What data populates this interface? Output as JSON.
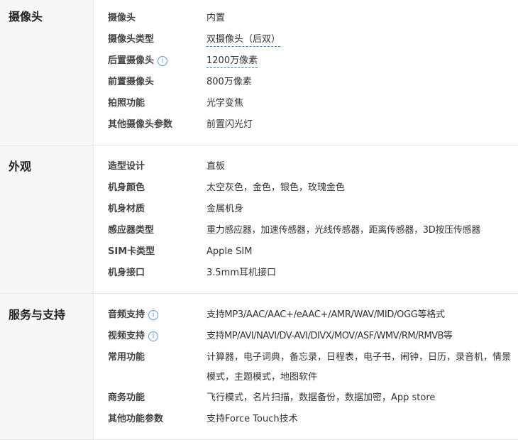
{
  "sections": [
    {
      "title": "摄像头",
      "rows": [
        {
          "label": "摄像头",
          "value": "内置"
        },
        {
          "label": "摄像头类型",
          "value": "双摄像头（后双）"
        },
        {
          "label": "后置摄像头",
          "value": "1200万像素"
        },
        {
          "label": "前置摄像头",
          "value": "800万像素"
        },
        {
          "label": "拍照功能",
          "value": "光学变焦"
        },
        {
          "label": "其他摄像头参数",
          "value": "前置闪光灯"
        }
      ]
    },
    {
      "title": "外观",
      "rows": [
        {
          "label": "造型设计",
          "value": "直板"
        },
        {
          "label": "机身颜色",
          "value": "太空灰色，金色，银色，玫瑰金色"
        },
        {
          "label": "机身材质",
          "value": "金属机身"
        },
        {
          "label": "感应器类型",
          "value": "重力感应器，加速传感器，光线传感器，距离传感器，3D按压传感器"
        },
        {
          "label": "SIM卡类型",
          "value": "Apple SIM"
        },
        {
          "label": "机身接口",
          "value": "3.5mm耳机接口"
        }
      ]
    },
    {
      "title": "服务与支持",
      "rows": [
        {
          "label": "音频支持",
          "value": "支持MP3/AAC/AAC+/eAAC+/AMR/WAV/MID/OGG等格式"
        },
        {
          "label": "视频支持",
          "value": "支持MP/AVI/NAVI/DV-AVI/DIVX/MOV/ASF/WMV/RM/RMVB等"
        },
        {
          "label": "常用功能",
          "value": "计算器，电子词典，备忘录，日程表，电子书，闹钟，日历，录音机，情景模式，主题模式，地图软件"
        },
        {
          "label": "商务功能",
          "value": "飞行模式，名片扫描，数据备份，数据加密，App store"
        },
        {
          "label": "其他功能参数",
          "value": "支持Force Touch技术"
        }
      ]
    }
  ],
  "info_icon_glyph": "i"
}
